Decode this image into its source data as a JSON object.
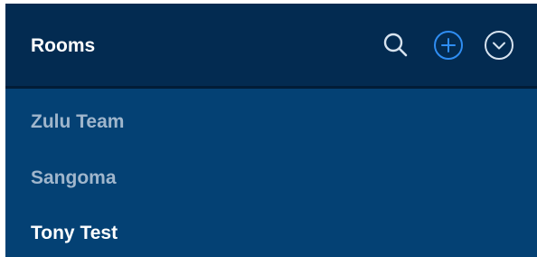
{
  "header": {
    "title": "Rooms",
    "icons": {
      "search": "search-icon",
      "add": "add-circle-icon",
      "dropdown": "chevron-down-circle-icon"
    }
  },
  "rooms": [
    {
      "name": "Zulu Team",
      "active": false
    },
    {
      "name": "Sangoma",
      "active": false
    },
    {
      "name": "Tony Test",
      "active": true
    }
  ],
  "colors": {
    "header_bg": "#032b51",
    "list_bg": "#044174",
    "accent_blue": "#2f8df2",
    "inactive_text": "#a0b6cc",
    "active_text": "#ffffff"
  }
}
